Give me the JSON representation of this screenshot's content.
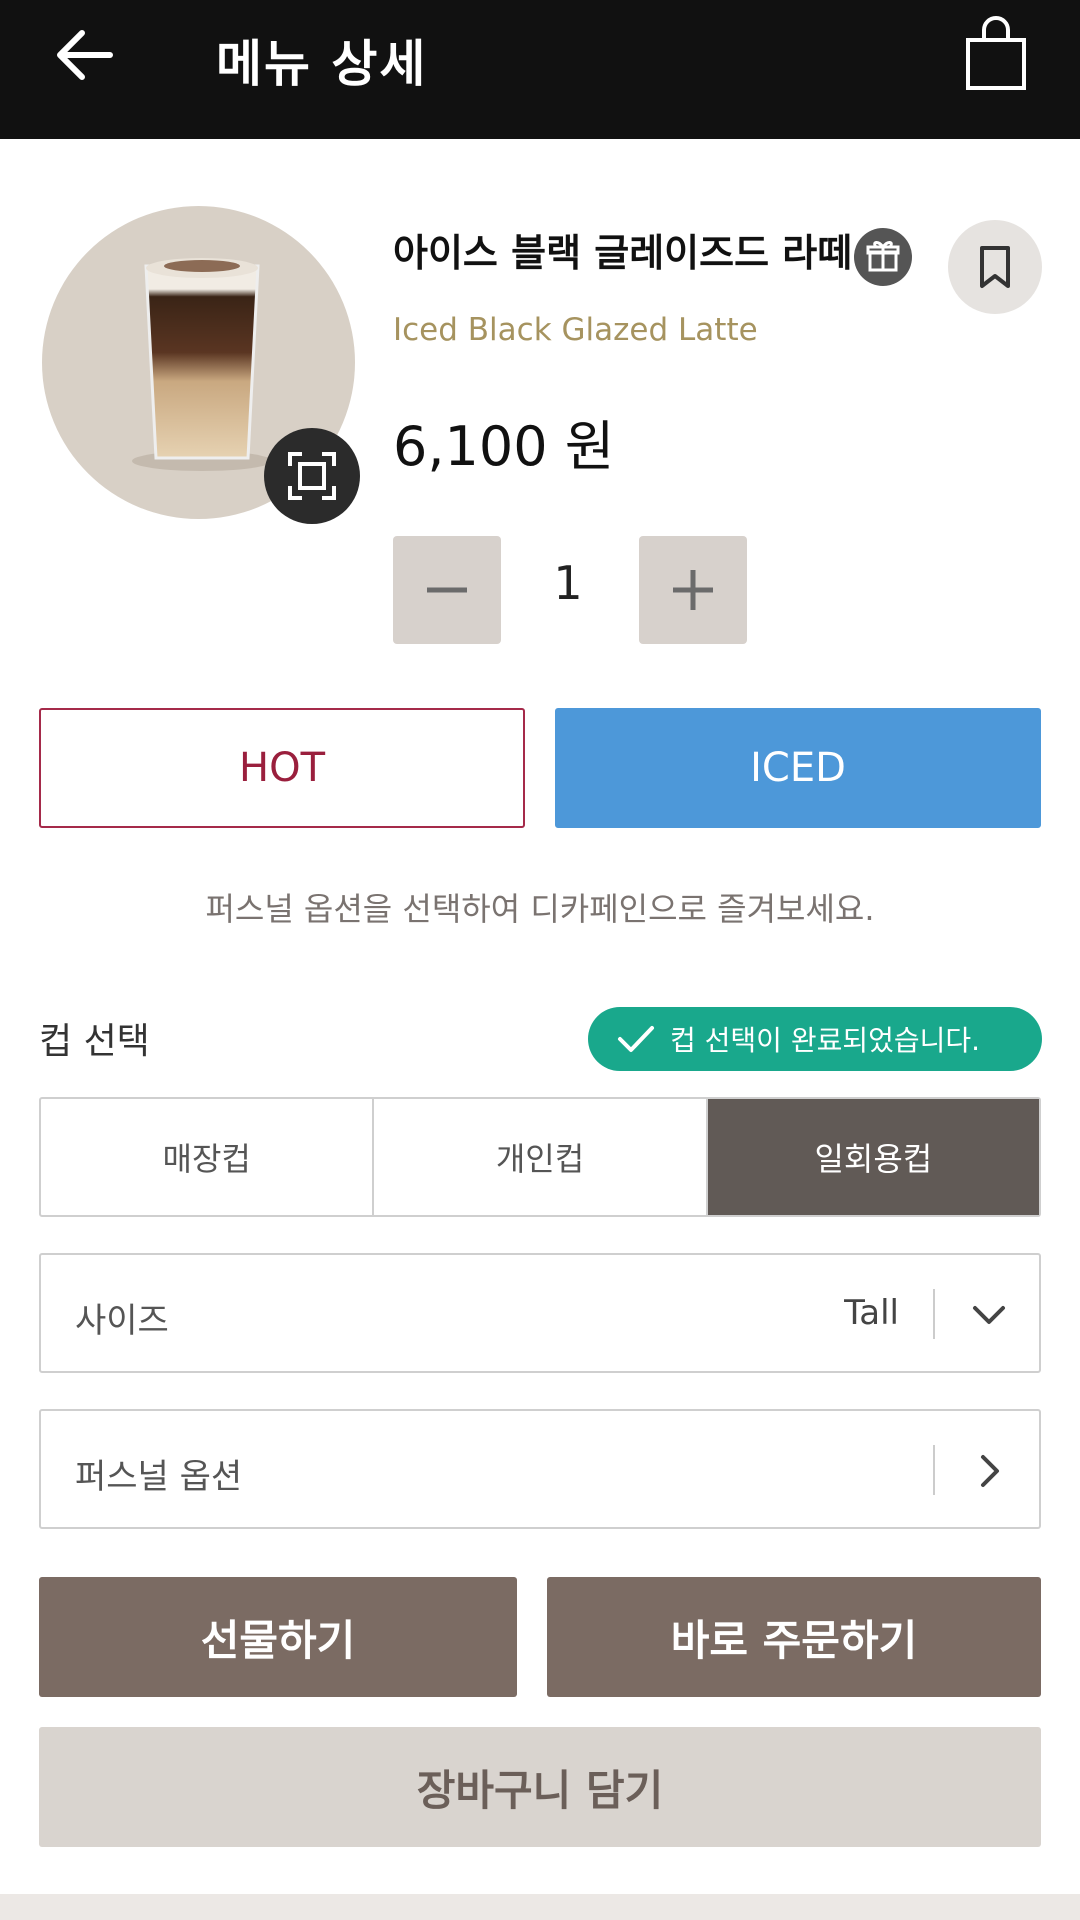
{
  "header": {
    "title": "메뉴 상세",
    "back_icon": "arrow-left-icon",
    "cart_icon": "shopping-bag-icon"
  },
  "product": {
    "name_ko": "아이스 블랙 글레이즈드 라떼",
    "name_en": "Iced Black Glazed Latte",
    "price": "6,100 원",
    "gift_icon": "gift-icon",
    "bookmark_icon": "bookmark-icon",
    "zoom_icon": "expand-icon"
  },
  "quantity": {
    "value": "1",
    "minus_icon": "minus-icon",
    "plus_icon": "plus-icon"
  },
  "temperature": {
    "hot_label": "HOT",
    "iced_label": "ICED",
    "selected": "ICED"
  },
  "decaf_note": "퍼스널 옵션을 선택하여 디카페인으로 즐겨보세요.",
  "cup": {
    "label": "컵 선택",
    "badge": "컵 선택이 완료되었습니다.",
    "options": [
      "매장컵",
      "개인컵",
      "일회용컵"
    ],
    "selected": "일회용컵"
  },
  "size": {
    "label": "사이즈",
    "value": "Tall"
  },
  "personal_option": {
    "label": "퍼스널 옵션"
  },
  "actions": {
    "gift": "선물하기",
    "order_now": "바로 주문하기",
    "add_to_cart": "장바구니 담기"
  },
  "colors": {
    "header_bg": "#111111",
    "iced_blue": "#4d98d9",
    "hot_red": "#9a1f3d",
    "badge_green": "#19a88c",
    "button_brown": "#7b6b63",
    "english_name_gold": "#a6935f"
  }
}
